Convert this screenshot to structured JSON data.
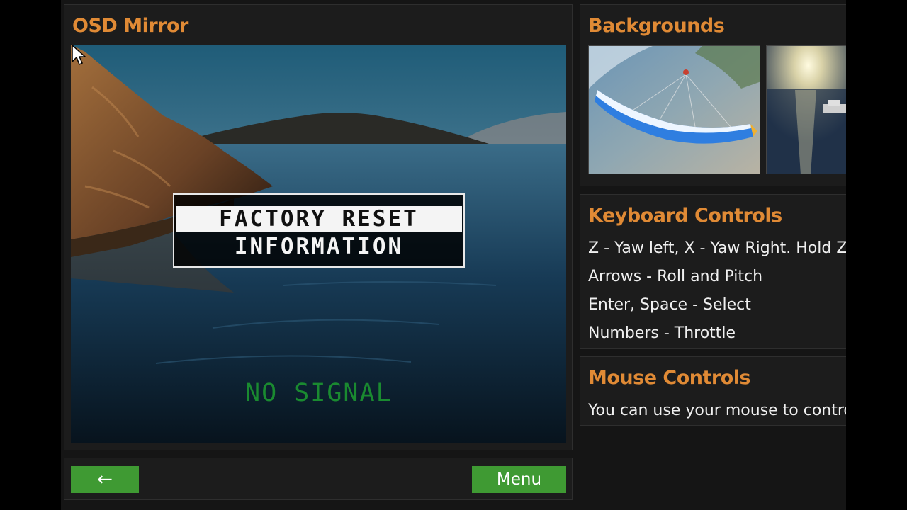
{
  "osd": {
    "title": "OSD Mirror",
    "menu_items": [
      "FACTORY RESET",
      "INFORMATION"
    ],
    "status": "NO SIGNAL"
  },
  "nav": {
    "back_label": "←",
    "menu_label": "Menu"
  },
  "backgrounds": {
    "title": "Backgrounds"
  },
  "keyboard": {
    "title": "Keyboard Controls",
    "lines": [
      "Z - Yaw left, X - Yaw Right. Hold Z",
      "Arrows - Roll and Pitch",
      "Enter, Space - Select",
      "Numbers - Throttle"
    ]
  },
  "mouse": {
    "title": "Mouse Controls",
    "text": "You can use your mouse to contro"
  },
  "colors": {
    "accent": "#e08a35",
    "button": "#3f9a33",
    "osd_signal": "#1a8a30"
  },
  "icons": {
    "back": "arrow-left-icon",
    "cursor": "mouse-pointer-icon"
  }
}
